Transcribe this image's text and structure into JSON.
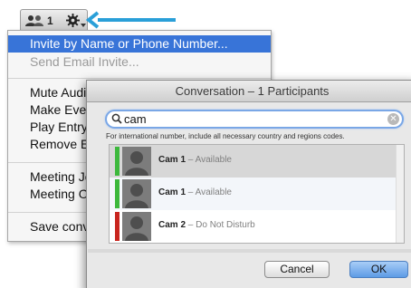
{
  "toolbar": {
    "participant_count": "1",
    "participants_icon": "participants-icon",
    "settings_icon": "gear-icon"
  },
  "annotation": {
    "arrow_color": "#2a9fd8"
  },
  "menu": {
    "items": [
      {
        "label": "Invite by Name or Phone Number...",
        "state": "highlighted"
      },
      {
        "label": "Send Email Invite...",
        "state": "disabled"
      },
      {
        "label": "Mute Audience"
      },
      {
        "label": "Make Everyone a Presenter"
      },
      {
        "label": "Play Entry and Exit Announcement"
      },
      {
        "label": "Remove Everyone"
      },
      {
        "label": "Meeting Join Info"
      },
      {
        "label": "Meeting Options"
      },
      {
        "label": "Save conversation"
      }
    ]
  },
  "dialog": {
    "title": "Conversation – 1 Participants",
    "search_value": "cam",
    "hint": "For international number, include all necessary country and regions codes.",
    "contacts": [
      {
        "name": "Cam 1",
        "status": "– Available",
        "status_color": "#3cb83c",
        "selected": true
      },
      {
        "name": "Cam 1",
        "status": "– Available",
        "status_color": "#3cb83c",
        "selected": false
      },
      {
        "name": "Cam 2",
        "status": "– Do Not Disturb",
        "status_color": "#c8251e",
        "selected": false
      }
    ],
    "cancel_label": "Cancel",
    "ok_label": "OK"
  },
  "colors": {
    "menu_highlight": "#3874d8",
    "ok_button": "#5d9be6",
    "search_focus": "#7aa7e6"
  }
}
